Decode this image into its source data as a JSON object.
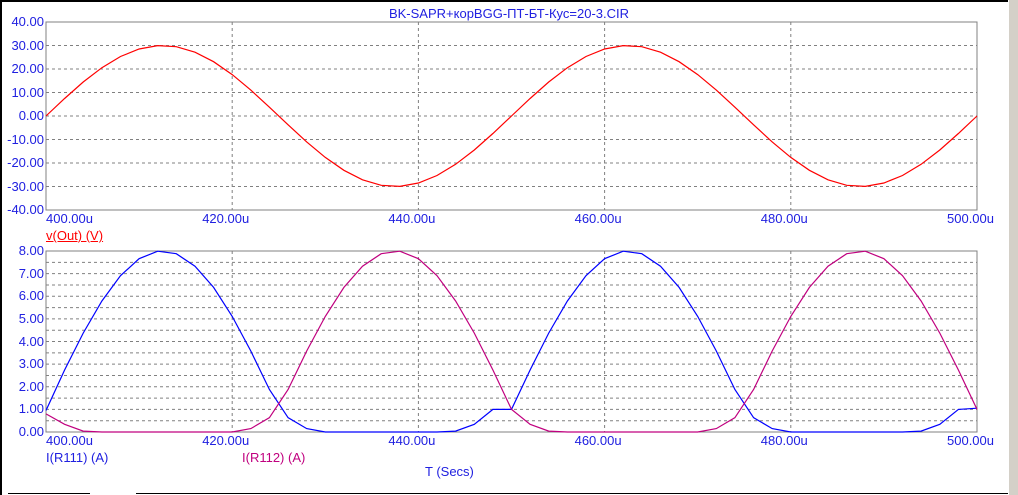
{
  "title": "BK-SAPR+корBGG-ПТ-БТ-Кус=20-3.CIR",
  "x_axis_label": "T (Secs)",
  "colors": {
    "axis_text": "#2020e0",
    "voltage": "#ff0000",
    "i111": "#0000ff",
    "i112": "#c0007f",
    "grid": "#808080"
  },
  "chart_data": [
    {
      "type": "line",
      "title": "BK-SAPR+корBGG-ПТ-БТ-Кус=20-3.CIR",
      "xlabel": "T (Secs)",
      "xlim": [
        400,
        500
      ],
      "ylim": [
        -40,
        40
      ],
      "x_ticks": [
        "400.00u",
        "420.00u",
        "440.00u",
        "460.00u",
        "480.00u",
        "500.00u"
      ],
      "y_ticks": [
        "40.00",
        "30.00",
        "20.00",
        "10.00",
        "0.00",
        "-10.00",
        "-20.00",
        "-30.00",
        "-40.00"
      ],
      "grid": true,
      "x": [
        400,
        402,
        404,
        406,
        408,
        410,
        412,
        414,
        416,
        418,
        420,
        422,
        424,
        426,
        428,
        430,
        432,
        434,
        436,
        438,
        440,
        442,
        444,
        446,
        448,
        450,
        452,
        454,
        456,
        458,
        460,
        462,
        464,
        466,
        468,
        470,
        472,
        474,
        476,
        478,
        480,
        482,
        484,
        486,
        488,
        490,
        492,
        494,
        496,
        498,
        500
      ],
      "series": [
        {
          "name": "v(Out) (V)",
          "values": [
            0,
            7.46,
            14.45,
            20.54,
            25.33,
            28.53,
            29.94,
            29.47,
            27.14,
            23.12,
            17.63,
            11.04,
            3.76,
            -3.76,
            -11.04,
            -17.63,
            -23.12,
            -27.14,
            -29.47,
            -29.94,
            -28.53,
            -25.33,
            -20.54,
            -14.45,
            -7.46,
            0,
            7.46,
            14.45,
            20.54,
            25.33,
            28.53,
            29.94,
            29.47,
            27.14,
            23.12,
            17.63,
            11.04,
            3.76,
            -3.76,
            -11.04,
            -17.63,
            -23.12,
            -27.14,
            -29.47,
            -29.94,
            -28.53,
            -25.33,
            -20.54,
            -14.45,
            -7.46,
            0
          ]
        }
      ]
    },
    {
      "type": "line",
      "xlabel": "T (Secs)",
      "xlim": [
        400,
        500
      ],
      "ylim": [
        0,
        8
      ],
      "x_ticks": [
        "400.00u",
        "420.00u",
        "440.00u",
        "460.00u",
        "480.00u",
        "500.00u"
      ],
      "y_ticks": [
        "8.00",
        "7.00",
        "6.00",
        "5.00",
        "4.00",
        "3.00",
        "2.00",
        "1.00",
        "0.00"
      ],
      "grid": true,
      "x": [
        400,
        402,
        404,
        406,
        408,
        410,
        412,
        414,
        416,
        418,
        420,
        422,
        424,
        426,
        428,
        430,
        432,
        434,
        436,
        438,
        440,
        442,
        444,
        446,
        448,
        450,
        452,
        454,
        456,
        458,
        460,
        462,
        464,
        466,
        468,
        470,
        472,
        474,
        476,
        478,
        480,
        482,
        484,
        486,
        488,
        490,
        492,
        494,
        496,
        498,
        500
      ],
      "series": [
        {
          "name": "I(R111) (A)",
          "values": [
            0.95,
            2.74,
            4.37,
            5.79,
            6.91,
            7.66,
            7.99,
            7.88,
            7.33,
            6.39,
            5.11,
            3.58,
            1.88,
            0.63,
            0.15,
            0,
            0,
            0,
            0,
            0,
            0,
            0,
            0.04,
            0.34,
            1.0,
            1.0,
            2.74,
            4.37,
            5.79,
            6.91,
            7.66,
            7.99,
            7.88,
            7.33,
            6.39,
            5.11,
            3.58,
            1.88,
            0.63,
            0.15,
            0,
            0,
            0,
            0,
            0,
            0,
            0,
            0.04,
            0.34,
            1.0,
            1.05
          ]
        },
        {
          "name": "I(R112) (A)",
          "values": [
            0.8,
            0.34,
            0.04,
            0,
            0,
            0,
            0,
            0,
            0,
            0,
            0,
            0.15,
            0.63,
            1.88,
            3.58,
            5.11,
            6.39,
            7.33,
            7.88,
            7.99,
            7.66,
            6.91,
            5.79,
            4.37,
            2.74,
            1.0,
            0.34,
            0.04,
            0,
            0,
            0,
            0,
            0,
            0,
            0,
            0,
            0.15,
            0.63,
            1.88,
            3.58,
            5.11,
            6.39,
            7.33,
            7.88,
            7.99,
            7.66,
            6.91,
            5.79,
            4.37,
            2.74,
            1.0
          ]
        }
      ]
    }
  ]
}
